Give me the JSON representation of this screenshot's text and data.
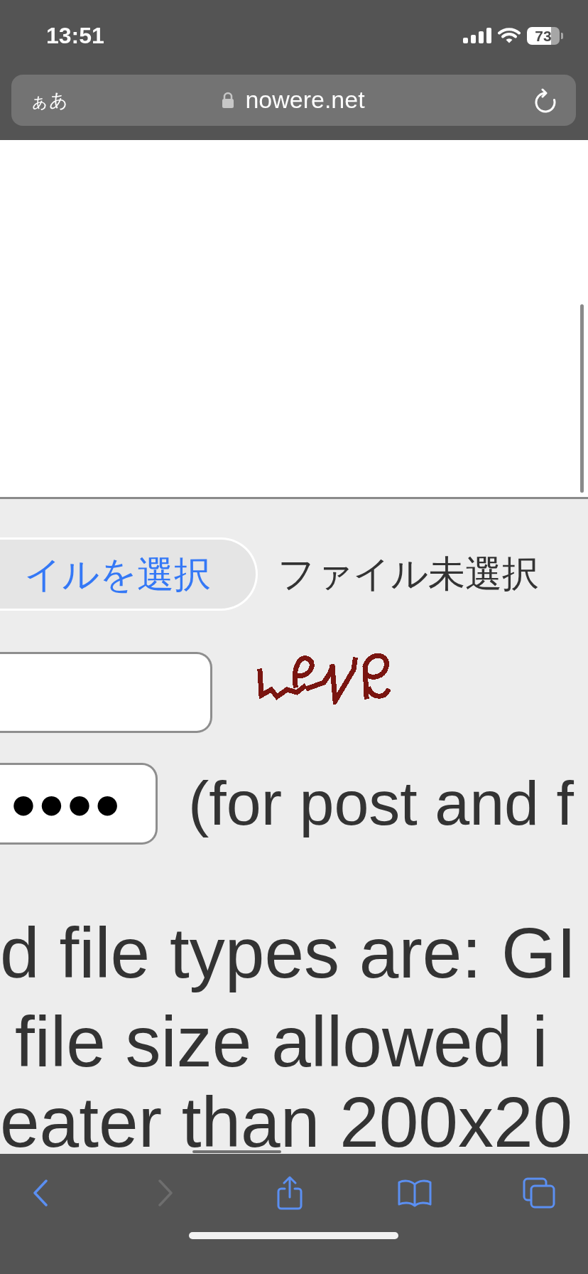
{
  "status_bar": {
    "time": "13:51",
    "battery": "73"
  },
  "address_bar": {
    "text_size": "ぁあ",
    "url": "nowere.net"
  },
  "file_input": {
    "button": "イルを選択",
    "status": "ファイル未選択"
  },
  "password": {
    "value": "●●●●",
    "note": "(for post and f"
  },
  "notes": [
    "d file types are: GI",
    "file size allowed i",
    "eater than 200x20"
  ],
  "toolbar": [
    {
      "kind": "back",
      "disabled": false
    },
    {
      "kind": "forward",
      "disabled": true
    },
    {
      "kind": "share",
      "disabled": false
    },
    {
      "kind": "bookmarks",
      "disabled": false
    },
    {
      "kind": "tabs",
      "disabled": false
    }
  ]
}
